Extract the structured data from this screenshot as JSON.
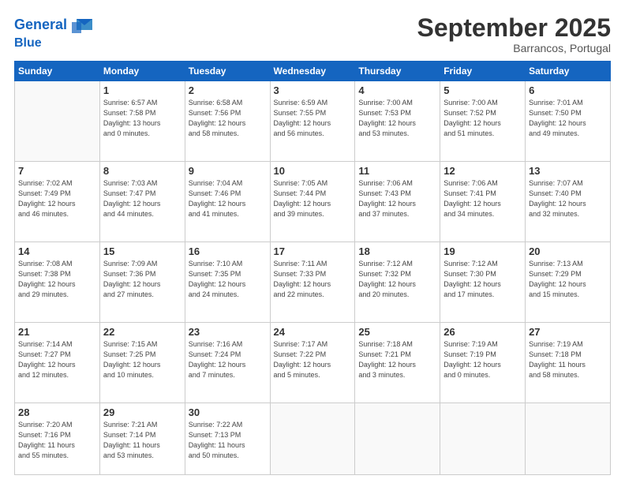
{
  "header": {
    "logo_line1": "General",
    "logo_line2": "Blue",
    "title": "September 2025",
    "location": "Barrancos, Portugal"
  },
  "days_of_week": [
    "Sunday",
    "Monday",
    "Tuesday",
    "Wednesday",
    "Thursday",
    "Friday",
    "Saturday"
  ],
  "weeks": [
    [
      {
        "day": "",
        "info": ""
      },
      {
        "day": "1",
        "info": "Sunrise: 6:57 AM\nSunset: 7:58 PM\nDaylight: 13 hours\nand 0 minutes."
      },
      {
        "day": "2",
        "info": "Sunrise: 6:58 AM\nSunset: 7:56 PM\nDaylight: 12 hours\nand 58 minutes."
      },
      {
        "day": "3",
        "info": "Sunrise: 6:59 AM\nSunset: 7:55 PM\nDaylight: 12 hours\nand 56 minutes."
      },
      {
        "day": "4",
        "info": "Sunrise: 7:00 AM\nSunset: 7:53 PM\nDaylight: 12 hours\nand 53 minutes."
      },
      {
        "day": "5",
        "info": "Sunrise: 7:00 AM\nSunset: 7:52 PM\nDaylight: 12 hours\nand 51 minutes."
      },
      {
        "day": "6",
        "info": "Sunrise: 7:01 AM\nSunset: 7:50 PM\nDaylight: 12 hours\nand 49 minutes."
      }
    ],
    [
      {
        "day": "7",
        "info": "Sunrise: 7:02 AM\nSunset: 7:49 PM\nDaylight: 12 hours\nand 46 minutes."
      },
      {
        "day": "8",
        "info": "Sunrise: 7:03 AM\nSunset: 7:47 PM\nDaylight: 12 hours\nand 44 minutes."
      },
      {
        "day": "9",
        "info": "Sunrise: 7:04 AM\nSunset: 7:46 PM\nDaylight: 12 hours\nand 41 minutes."
      },
      {
        "day": "10",
        "info": "Sunrise: 7:05 AM\nSunset: 7:44 PM\nDaylight: 12 hours\nand 39 minutes."
      },
      {
        "day": "11",
        "info": "Sunrise: 7:06 AM\nSunset: 7:43 PM\nDaylight: 12 hours\nand 37 minutes."
      },
      {
        "day": "12",
        "info": "Sunrise: 7:06 AM\nSunset: 7:41 PM\nDaylight: 12 hours\nand 34 minutes."
      },
      {
        "day": "13",
        "info": "Sunrise: 7:07 AM\nSunset: 7:40 PM\nDaylight: 12 hours\nand 32 minutes."
      }
    ],
    [
      {
        "day": "14",
        "info": "Sunrise: 7:08 AM\nSunset: 7:38 PM\nDaylight: 12 hours\nand 29 minutes."
      },
      {
        "day": "15",
        "info": "Sunrise: 7:09 AM\nSunset: 7:36 PM\nDaylight: 12 hours\nand 27 minutes."
      },
      {
        "day": "16",
        "info": "Sunrise: 7:10 AM\nSunset: 7:35 PM\nDaylight: 12 hours\nand 24 minutes."
      },
      {
        "day": "17",
        "info": "Sunrise: 7:11 AM\nSunset: 7:33 PM\nDaylight: 12 hours\nand 22 minutes."
      },
      {
        "day": "18",
        "info": "Sunrise: 7:12 AM\nSunset: 7:32 PM\nDaylight: 12 hours\nand 20 minutes."
      },
      {
        "day": "19",
        "info": "Sunrise: 7:12 AM\nSunset: 7:30 PM\nDaylight: 12 hours\nand 17 minutes."
      },
      {
        "day": "20",
        "info": "Sunrise: 7:13 AM\nSunset: 7:29 PM\nDaylight: 12 hours\nand 15 minutes."
      }
    ],
    [
      {
        "day": "21",
        "info": "Sunrise: 7:14 AM\nSunset: 7:27 PM\nDaylight: 12 hours\nand 12 minutes."
      },
      {
        "day": "22",
        "info": "Sunrise: 7:15 AM\nSunset: 7:25 PM\nDaylight: 12 hours\nand 10 minutes."
      },
      {
        "day": "23",
        "info": "Sunrise: 7:16 AM\nSunset: 7:24 PM\nDaylight: 12 hours\nand 7 minutes."
      },
      {
        "day": "24",
        "info": "Sunrise: 7:17 AM\nSunset: 7:22 PM\nDaylight: 12 hours\nand 5 minutes."
      },
      {
        "day": "25",
        "info": "Sunrise: 7:18 AM\nSunset: 7:21 PM\nDaylight: 12 hours\nand 3 minutes."
      },
      {
        "day": "26",
        "info": "Sunrise: 7:19 AM\nSunset: 7:19 PM\nDaylight: 12 hours\nand 0 minutes."
      },
      {
        "day": "27",
        "info": "Sunrise: 7:19 AM\nSunset: 7:18 PM\nDaylight: 11 hours\nand 58 minutes."
      }
    ],
    [
      {
        "day": "28",
        "info": "Sunrise: 7:20 AM\nSunset: 7:16 PM\nDaylight: 11 hours\nand 55 minutes."
      },
      {
        "day": "29",
        "info": "Sunrise: 7:21 AM\nSunset: 7:14 PM\nDaylight: 11 hours\nand 53 minutes."
      },
      {
        "day": "30",
        "info": "Sunrise: 7:22 AM\nSunset: 7:13 PM\nDaylight: 11 hours\nand 50 minutes."
      },
      {
        "day": "",
        "info": ""
      },
      {
        "day": "",
        "info": ""
      },
      {
        "day": "",
        "info": ""
      },
      {
        "day": "",
        "info": ""
      }
    ]
  ]
}
